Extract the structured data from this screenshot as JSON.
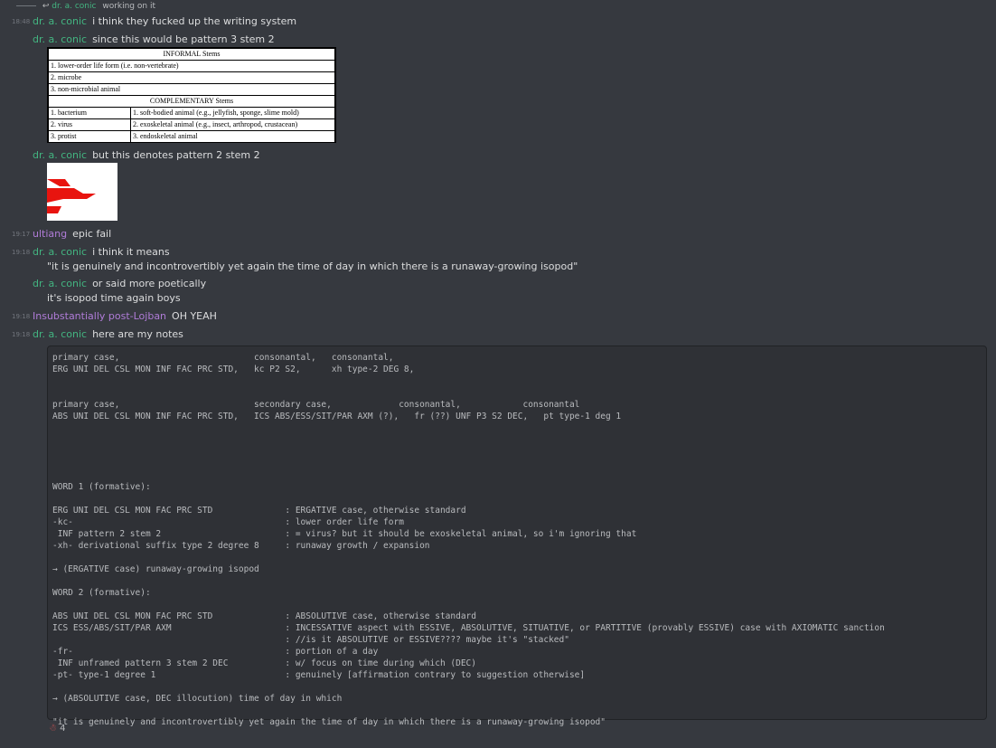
{
  "reply": {
    "author": "dr. a. conic",
    "text": "working on it"
  },
  "messages": [
    {
      "time": "18:48",
      "author": "dr. a. conic",
      "text": "i think they fucked up the writing system"
    },
    {
      "time": "",
      "author": "dr. a. conic",
      "text": "since this would be pattern 3 stem 2"
    },
    {
      "time": "",
      "author": "dr. a. conic",
      "text": "but this denotes pattern 2 stem 2"
    },
    {
      "time": "19:17",
      "author": "ultiang",
      "text": "epic fail"
    },
    {
      "time": "19:18",
      "author": "dr. a. conic",
      "text": "i think it means"
    },
    {
      "text": "\"it is genuinely and incontrovertibly yet again the time of day in which there is a runaway-growing isopod\""
    },
    {
      "time": "",
      "author": "dr. a. conic",
      "text": "or said more poetically"
    },
    {
      "text": "it's isopod time again boys"
    },
    {
      "time": "19:18",
      "author": "Insubstantially post-Lojban",
      "text": "OH YEAH"
    },
    {
      "time": "19:18",
      "author": "dr. a. conic",
      "text": "here are my notes"
    }
  ],
  "table": {
    "informal_header": "INFORMAL Stems",
    "informal_rows": [
      "1. lower-order life form (i.e. non-vertebrate)",
      "2. microbe",
      "3. non-microbial animal"
    ],
    "comp_header": "COMPLEMENTARY Stems",
    "comp_rows": [
      [
        "1. bacterium",
        "1. soft-bodied animal (e.g., jellyfish, sponge, slime mold)"
      ],
      [
        "2. virus",
        "2. exoskeletal animal (e.g., insect, arthropod, crustacean)"
      ],
      [
        "3. protist",
        "3. endoskeletal animal"
      ]
    ]
  },
  "notes": "primary case,                          consonantal,   consonantal,\nERG UNI DEL CSL MON INF FAC PRC STD,   kc P2 S2,      xh type-2 DEG 8,\n\n\nprimary case,                          secondary case,             consonantal,            consonantal\nABS UNI DEL CSL MON INF FAC PRC STD,   ICS ABS/ESS/SIT/PAR AXM (?),   fr (??) UNF P3 S2 DEC,   pt type-1 deg 1\n\n\n\n\n\nWORD 1 (formative):\n\nERG UNI DEL CSL MON FAC PRC STD              : ERGATIVE case, otherwise standard\n-kc-                                         : lower order life form\n INF pattern 2 stem 2                        : = virus? but it should be exoskeletal animal, so i'm ignoring that\n-xh- derivational suffix type 2 degree 8     : runaway growth / expansion\n\n→ (ERGATIVE case) runaway-growing isopod\n\nWORD 2 (formative):\n\nABS UNI DEL CSL MON FAC PRC STD              : ABSOLUTIVE case, otherwise standard\nICS ESS/ABS/SIT/PAR AXM                      : INCESSATIVE aspect with ESSIVE, ABSOLUTIVE, SITUATIVE, or PARTITIVE (provably ESSIVE) case with AXIOMATIC sanction\n                                             : //is it ABSOLUTIVE or ESSIVE???? maybe it's \"stacked\"\n-fr-                                         : portion of a day\n INF unframed pattern 3 stem 2 DEC           : w/ focus on time during which (DEC)\n-pt- type-1 degree 1                         : genuinely [affirmation contrary to suggestion otherwise]\n\n→ (ABSOLUTIVE case, DEC illocution) time of day in which\n\n\"it is genuinely and incontrovertibly yet again the time of day in which there is a runaway-growing isopod\"",
  "reaction": {
    "count": "4",
    "icon": "emoji-reaction-icon"
  },
  "colors": {
    "background": "#36393f",
    "author_green": "#43b581",
    "author_purple": "#b07cd8",
    "code_bg": "#2f3136"
  }
}
